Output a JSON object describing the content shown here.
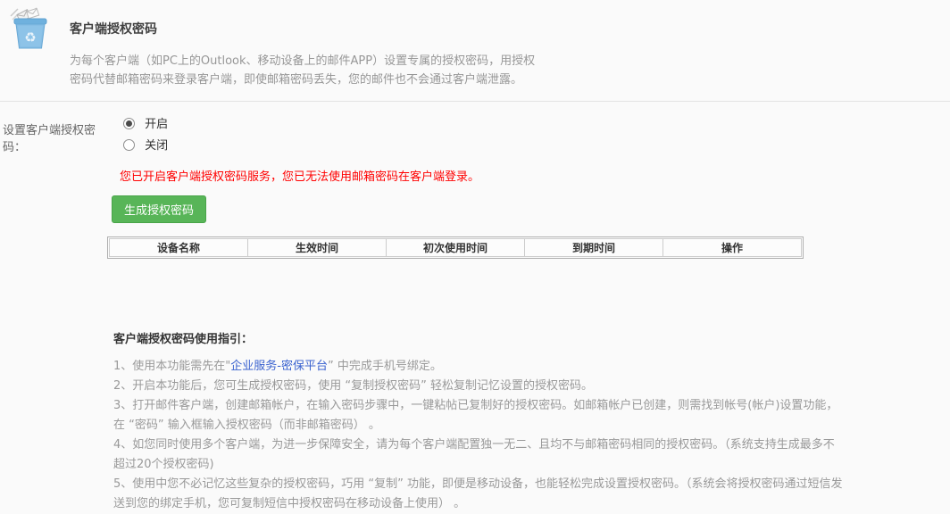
{
  "colors": {
    "page_bg": "#fafafa",
    "accent_green": "#58b558",
    "notice_red": "#ff0000",
    "link_blue": "#3a62cf"
  },
  "header": {
    "icon_name": "mail-client-trash-icon",
    "title": "客户端授权密码",
    "description": "为每个客户端（如PC上的Outlook、移动设备上的邮件APP）设置专属的授权密码，用授权\n密码代替邮箱密码来登录客户端，即使邮箱密码丢失，您的邮件也不会通过客户端泄露。"
  },
  "form": {
    "label": "设置客户端授权密码：",
    "options": [
      {
        "label": "开启",
        "selected": true
      },
      {
        "label": "关闭",
        "selected": false
      }
    ],
    "notice": "您已开启客户端授权密码服务，您已无法使用邮箱密码在客户端登录。",
    "generate_button": "生成授权密码"
  },
  "table": {
    "headers": [
      "设备名称",
      "生效时间",
      "初次使用时间",
      "到期时间",
      "操作"
    ],
    "rows": []
  },
  "guide": {
    "heading": "客户端授权密码使用指引：",
    "item1": {
      "prefix": "1、使用本功能需先在\"",
      "link": "企业服务-密保平台",
      "suffix": "” 中完成手机号绑定。"
    },
    "items": [
      "2、开启本功能后，您可生成授权密码，使用 “复制授权密码” 轻松复制记忆设置的授权密码。",
      "3、打开邮件客户端，创建邮箱帐户，在输入密码步骤中，一键粘帖已复制好的授权密码。如邮箱帐户已创建，则需找到帐号(帐户)设置功能，在 “密码” 输入框输入授权密码（而非邮箱密码） 。",
      "4、如您同时使用多个客户端，为进一步保障安全，请为每个客户端配置独一无二、且均不与邮箱密码相同的授权密码。（系统支持生成最多不超过20个授权密码)",
      "5、使用中您不必记忆这些复杂的授权密码，巧用 “复制” 功能，即便是移动设备，也能轻松完成设置授权密码。（系统会将授权密码通过短信发送到您的绑定手机，您可复制短信中授权密码在移动设备上使用） 。"
    ]
  }
}
